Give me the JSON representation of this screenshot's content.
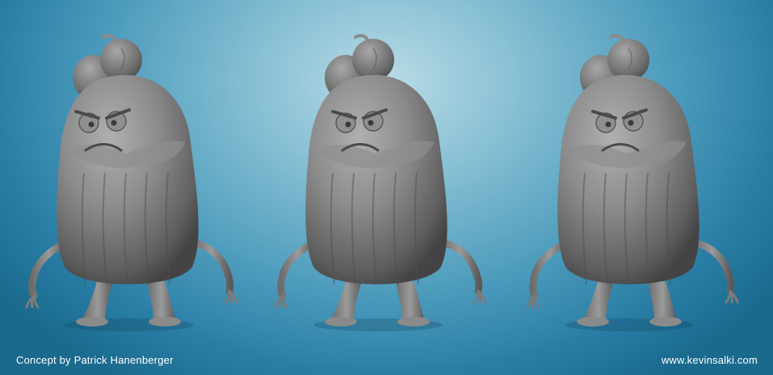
{
  "credits": {
    "concept": "Concept by Patrick Hanenberger",
    "website": "www.kevinsalki.com"
  },
  "colors": {
    "background_center": "#b9dbe6",
    "background_edge": "#1a6a8e",
    "clay_light": "#a2a2a2",
    "clay_mid": "#7e7e7e",
    "clay_dark": "#4a4a4a",
    "credit_text": "#ffffff"
  },
  "figures": [
    {
      "name": "pumpkin-creature-three-quarter-left",
      "facing": -1
    },
    {
      "name": "pumpkin-creature-front",
      "facing": 0
    },
    {
      "name": "pumpkin-creature-three-quarter-right",
      "facing": 1
    }
  ]
}
